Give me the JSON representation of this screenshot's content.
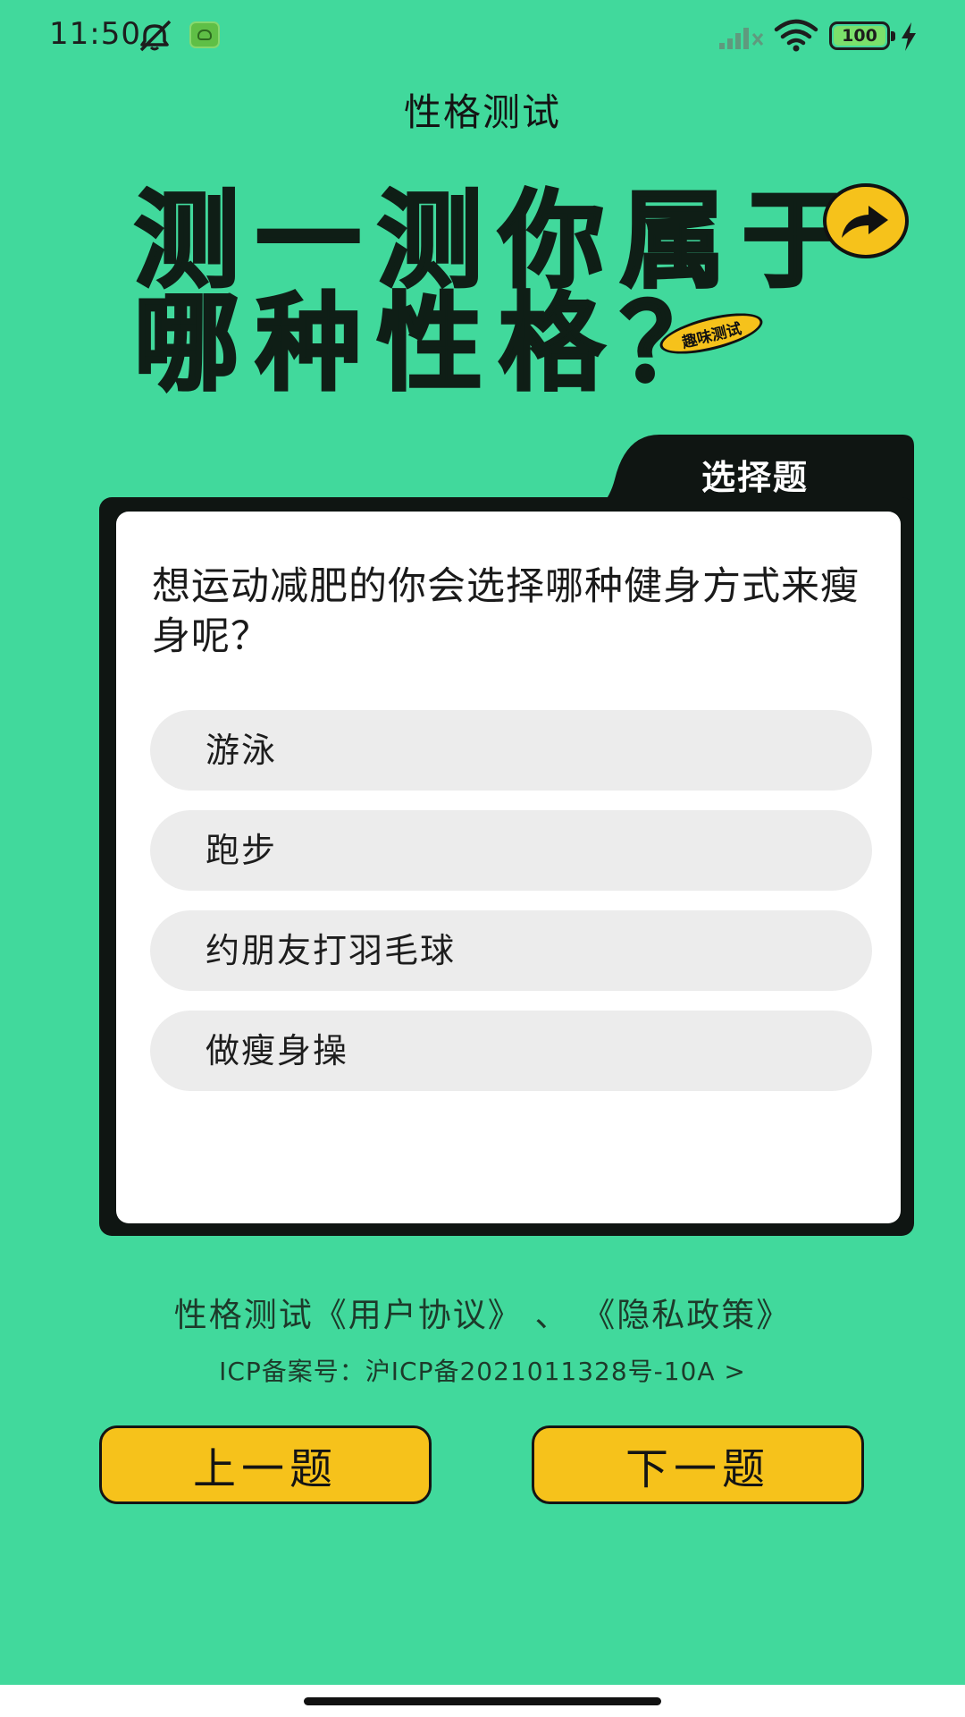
{
  "status_bar": {
    "time": "11:50",
    "battery": "100",
    "icons": [
      "mute-icon",
      "app-icon",
      "signal-icon",
      "wifi-icon",
      "battery-icon",
      "charging-bolt-icon"
    ]
  },
  "header": {
    "title": "性格测试"
  },
  "hero": {
    "line1": "测一测你属于",
    "line2": "哪种性格？",
    "tag": "趣味测试",
    "badge_icon": "share-arrow-icon",
    "colors": {
      "badge": "#f6c21b",
      "text": "#0f1e16"
    }
  },
  "quiz": {
    "tab_label": "选择题",
    "question": "想运动减肥的你会选择哪种健身方式来瘦身呢？",
    "options": [
      {
        "label": "游泳"
      },
      {
        "label": "跑步"
      },
      {
        "label": "约朋友打羽毛球"
      },
      {
        "label": "做瘦身操"
      }
    ]
  },
  "footer": {
    "prefix": "性格测试",
    "user_agreement": "《用户协议》",
    "separator": "、",
    "privacy_policy": "《隐私政策》",
    "icp": "ICP备案号：沪ICP备2021011328号-10A >"
  },
  "nav": {
    "prev_label": "上一题",
    "next_label": "下一题"
  },
  "colors": {
    "background": "#41d99c",
    "button": "#f6c21b",
    "card_frame": "#0f1512"
  }
}
